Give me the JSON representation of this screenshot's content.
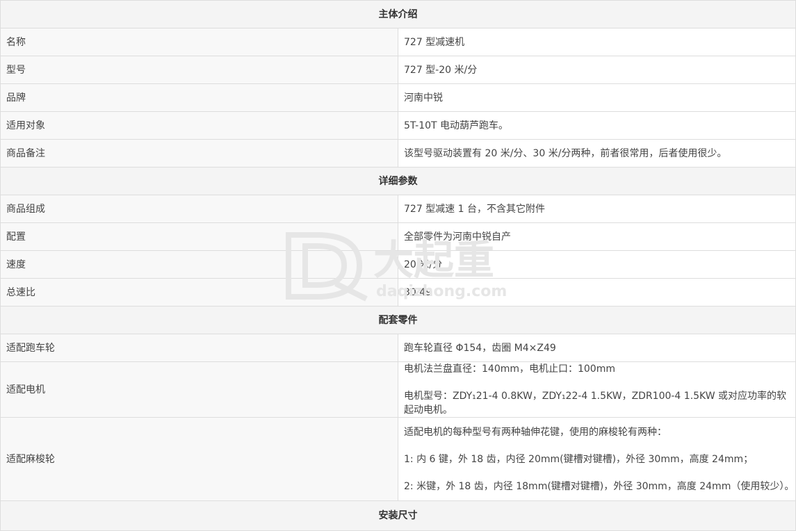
{
  "sections": {
    "main_intro": "主体介绍",
    "detail_params": "详细参数",
    "parts": "配套零件",
    "install_size": "安装尺寸"
  },
  "rows": {
    "name": {
      "label": "名称",
      "value": "727 型减速机"
    },
    "model": {
      "label": "型号",
      "value": "727 型-20 米/分"
    },
    "brand": {
      "label": "品牌",
      "value": "河南中锐"
    },
    "target": {
      "label": "适用对象",
      "value": "5T-10T 电动葫芦跑车。"
    },
    "note": {
      "label": "商品备注",
      "value": "该型号驱动装置有 20 米/分、30 米/分两种，前者很常用，后者使用很少。"
    },
    "composition": {
      "label": "商品组成",
      "value": "727 型减速 1 台，不含其它附件"
    },
    "config": {
      "label": "配置",
      "value": "全部零件为河南中锐自产"
    },
    "speed": {
      "label": "速度",
      "value": "20  米/分"
    },
    "ratio": {
      "label": "总速比",
      "value": "30.49"
    },
    "wheel": {
      "label": "适配跑车轮",
      "value": "跑车轮直径 Φ154，齿圈 M4×Z49"
    },
    "motor": {
      "label": "适配电机",
      "lines": [
        "电机法兰盘直径：140mm，电机止口：100mm",
        "电机型号：ZDY₁21-4    0.8KW，ZDY₁22-4    1.5KW，ZDR100-4    1.5KW 或对应功率的软起动电机。"
      ]
    },
    "spline": {
      "label": "适配麻梭轮",
      "lines": [
        "适配电机的每种型号有两种轴伸花键，使用的麻梭轮有两种：",
        "1:  内 6 键，外 18 齿，内径 20mm(键槽对键槽)，外径 30mm，高度 24mm；",
        "2:  米键，外 18 齿，内径 18mm(键槽对键槽)，外径 30mm，高度 24mm（使用较少）。"
      ]
    }
  },
  "watermark": {
    "text_cn": "大起重",
    "text_url": "daqizhong.com",
    "color": "#e6e6e6"
  }
}
